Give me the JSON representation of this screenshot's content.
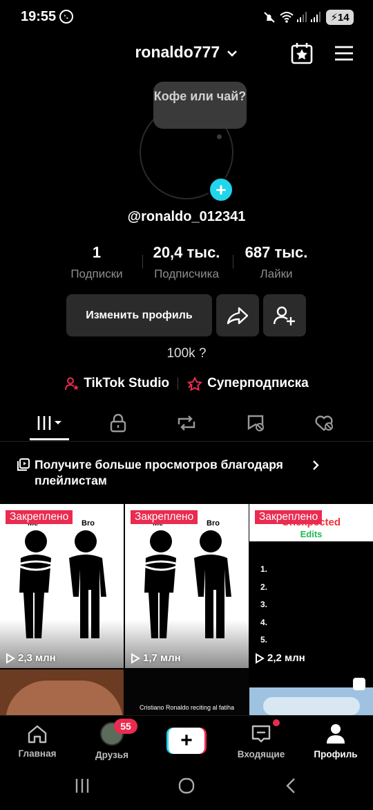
{
  "status": {
    "time": "19:55",
    "battery": "14"
  },
  "header": {
    "username": "ronaldo777"
  },
  "profile": {
    "bubble_text": "Кофе или чай?",
    "handle": "@ronaldo_012341",
    "stats": [
      {
        "value": "1",
        "label": "Подписки"
      },
      {
        "value": "20,4 тыс.",
        "label": "Подписчика"
      },
      {
        "value": "687 тыс.",
        "label": "Лайки"
      }
    ],
    "edit_button": "Изменить профиль",
    "bio": "100k ?",
    "links": {
      "studio": "TikTok Studio",
      "subscription": "Суперподписка"
    }
  },
  "playlist_banner": {
    "text": "Получите больше просмотров благодаря плейлистам"
  },
  "videos": [
    {
      "pinned": "Закреплено",
      "views": "2,3 млн",
      "caption_left": "Me",
      "caption_right": "Bro"
    },
    {
      "pinned": "Закреплено",
      "views": "1,7 млн",
      "caption_left": "Me",
      "caption_right": "Bro"
    },
    {
      "pinned": "Закреплено",
      "views": "2,2 млн",
      "title_line1": "Unexpected",
      "title_line2": "Edits",
      "list": [
        "1.",
        "2.",
        "3.",
        "4.",
        "5."
      ]
    },
    {
      "caption": ""
    },
    {
      "caption": "Cristiano Ronaldo reciting al fatiha"
    },
    {
      "caption": ""
    }
  ],
  "nav": {
    "home": "Главная",
    "friends": "Друзья",
    "friends_badge": "55",
    "inbox": "Входящие",
    "profile": "Профиль"
  },
  "colors": {
    "accent_red": "#ea2b4f",
    "accent_cyan": "#20d5ec",
    "background": "#000000"
  }
}
